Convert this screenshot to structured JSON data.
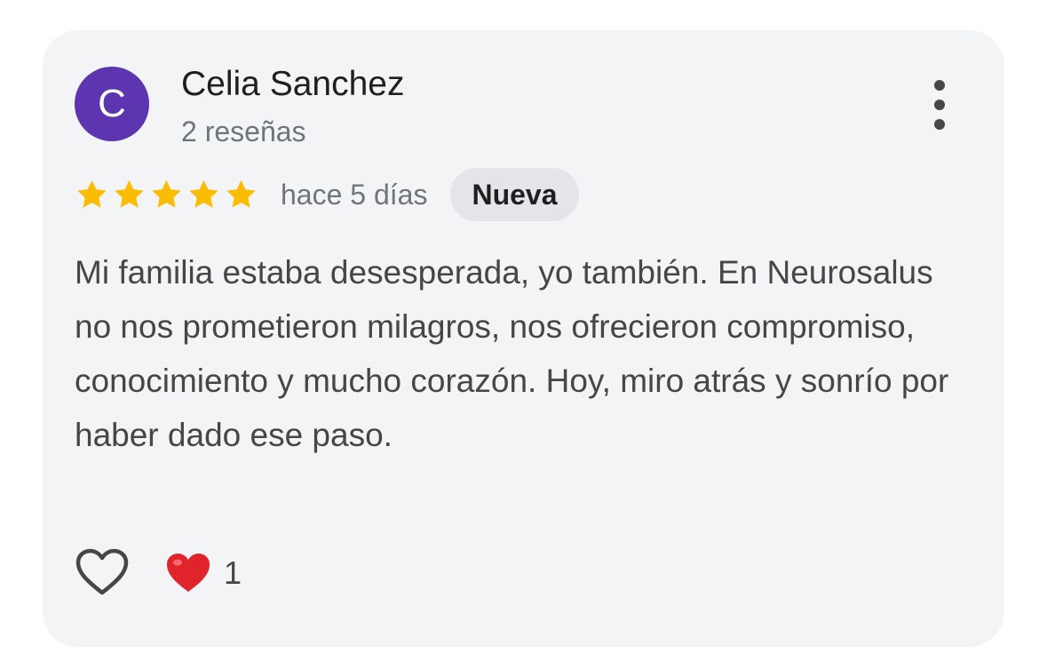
{
  "review": {
    "author_initial": "C",
    "author_name": "Celia Sanchez",
    "review_count": "2 reseñas",
    "rating": 5,
    "rating_max": 5,
    "time_ago": "hace 5 días",
    "badge": "Nueva",
    "text": "Mi familia estaba desesperada, yo también. En Neurosalus no nos prometieron milagros, nos ofrecieron compromiso, conocimiento y mucho corazón. Hoy, miro atrás y sonrío por haber dado ese paso.",
    "reaction_count": "1"
  },
  "icons": {
    "more": "more-vertical-icon",
    "like": "heart-outline-icon",
    "reaction": "red-heart-icon",
    "star": "star-icon"
  },
  "colors": {
    "avatar_bg": "#5e35b1",
    "star": "#fbbc04",
    "reaction_heart": "#e0242b",
    "card_bg": "#f3f4f6"
  }
}
